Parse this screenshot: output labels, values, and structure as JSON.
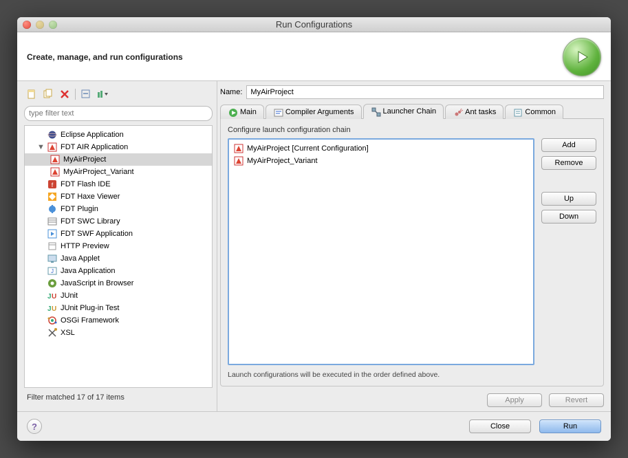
{
  "window_title": "Run Configurations",
  "header_text": "Create, manage, and run configurations",
  "filter_placeholder": "type filter text",
  "tree": [
    {
      "label": "Eclipse Application",
      "icon": "eclipse"
    },
    {
      "label": "FDT AIR Application",
      "icon": "air",
      "expanded": true,
      "children": [
        {
          "label": "MyAirProject",
          "icon": "air",
          "selected": true
        },
        {
          "label": "MyAirProject_Variant",
          "icon": "air"
        }
      ]
    },
    {
      "label": "FDT Flash IDE",
      "icon": "flash"
    },
    {
      "label": "FDT Haxe Viewer",
      "icon": "haxe"
    },
    {
      "label": "FDT Plugin",
      "icon": "plugin"
    },
    {
      "label": "FDT SWC Library",
      "icon": "swc"
    },
    {
      "label": "FDT SWF Application",
      "icon": "swf"
    },
    {
      "label": "HTTP Preview",
      "icon": "http"
    },
    {
      "label": "Java Applet",
      "icon": "applet"
    },
    {
      "label": "Java Application",
      "icon": "java"
    },
    {
      "label": "JavaScript in Browser",
      "icon": "js"
    },
    {
      "label": "JUnit",
      "icon": "junit"
    },
    {
      "label": "JUnit Plug-in Test",
      "icon": "junit-plugin"
    },
    {
      "label": "OSGi Framework",
      "icon": "osgi"
    },
    {
      "label": "XSL",
      "icon": "xsl"
    }
  ],
  "filter_status": "Filter matched 17 of 17 items",
  "name_label": "Name:",
  "name_value": "MyAirProject",
  "tabs": [
    {
      "label": "Main",
      "icon": "green-circle"
    },
    {
      "label": "Compiler Arguments",
      "icon": "args"
    },
    {
      "label": "Launcher Chain",
      "icon": "chain",
      "active": true
    },
    {
      "label": "Ant tasks",
      "icon": "ant"
    },
    {
      "label": "Common",
      "icon": "common"
    }
  ],
  "group_title": "Configure launch configuration chain",
  "chain_items": [
    {
      "label": "MyAirProject [Current Configuration]",
      "icon": "air"
    },
    {
      "label": "MyAirProject_Variant",
      "icon": "air"
    }
  ],
  "buttons": {
    "add": "Add",
    "remove": "Remove",
    "up": "Up",
    "down": "Down"
  },
  "note": "Launch configurations will be executed in the order defined above.",
  "apply": "Apply",
  "revert": "Revert",
  "close": "Close",
  "run": "Run",
  "help": "?"
}
